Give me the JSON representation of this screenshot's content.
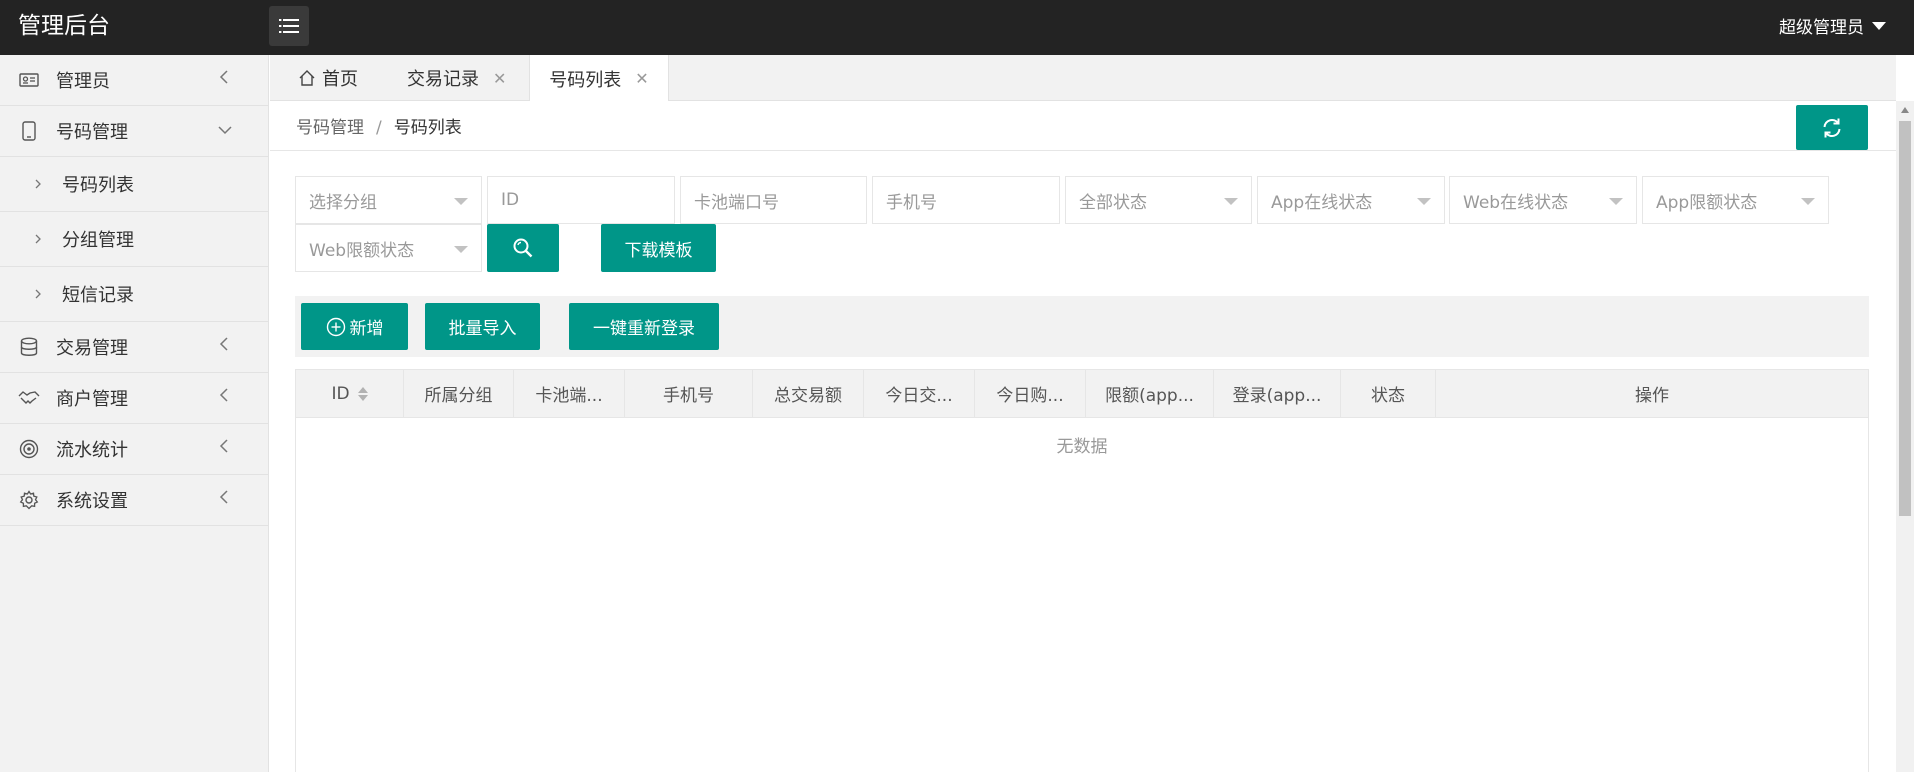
{
  "header": {
    "logo": "管理后台",
    "user": "超级管理员"
  },
  "sidebar": {
    "admin": "管理员",
    "number_mgmt": "号码管理",
    "sub_number_list": "号码列表",
    "sub_group_mgmt": "分组管理",
    "sub_sms_records": "短信记录",
    "trade_mgmt": "交易管理",
    "merchant_mgmt": "商户管理",
    "flow_stats": "流水统计",
    "system_settings": "系统设置"
  },
  "tabs": {
    "home": "首页",
    "trade_records": "交易记录",
    "number_list": "号码列表",
    "close": "✕"
  },
  "breadcrumb": {
    "parent": "号码管理",
    "separator": "/",
    "current": "号码列表"
  },
  "filters": {
    "group": "选择分组",
    "id": "ID",
    "card_port": "卡池端口号",
    "phone": "手机号",
    "status": "全部状态",
    "app_online": "App在线状态",
    "web_online": "Web在线状态",
    "app_limit": "App限额状态",
    "web_limit": "Web限额状态"
  },
  "buttons": {
    "download_template": "下载模板",
    "add": "新增",
    "batch_import": "批量导入",
    "relogin_all": "一键重新登录"
  },
  "table": {
    "columns": {
      "id": "ID",
      "group": "所属分组",
      "card_port": "卡池端...",
      "phone": "手机号",
      "total_amount": "总交易额",
      "today_trade": "今日交...",
      "today_buy": "今日购...",
      "limit_app": "限额(app...",
      "login_app": "登录(app...",
      "status": "状态",
      "actions": "操作"
    },
    "empty_text": "无数据"
  },
  "colors": {
    "primary": "#009688",
    "topbar": "#232323",
    "sidebar": "#f2f2f2"
  }
}
